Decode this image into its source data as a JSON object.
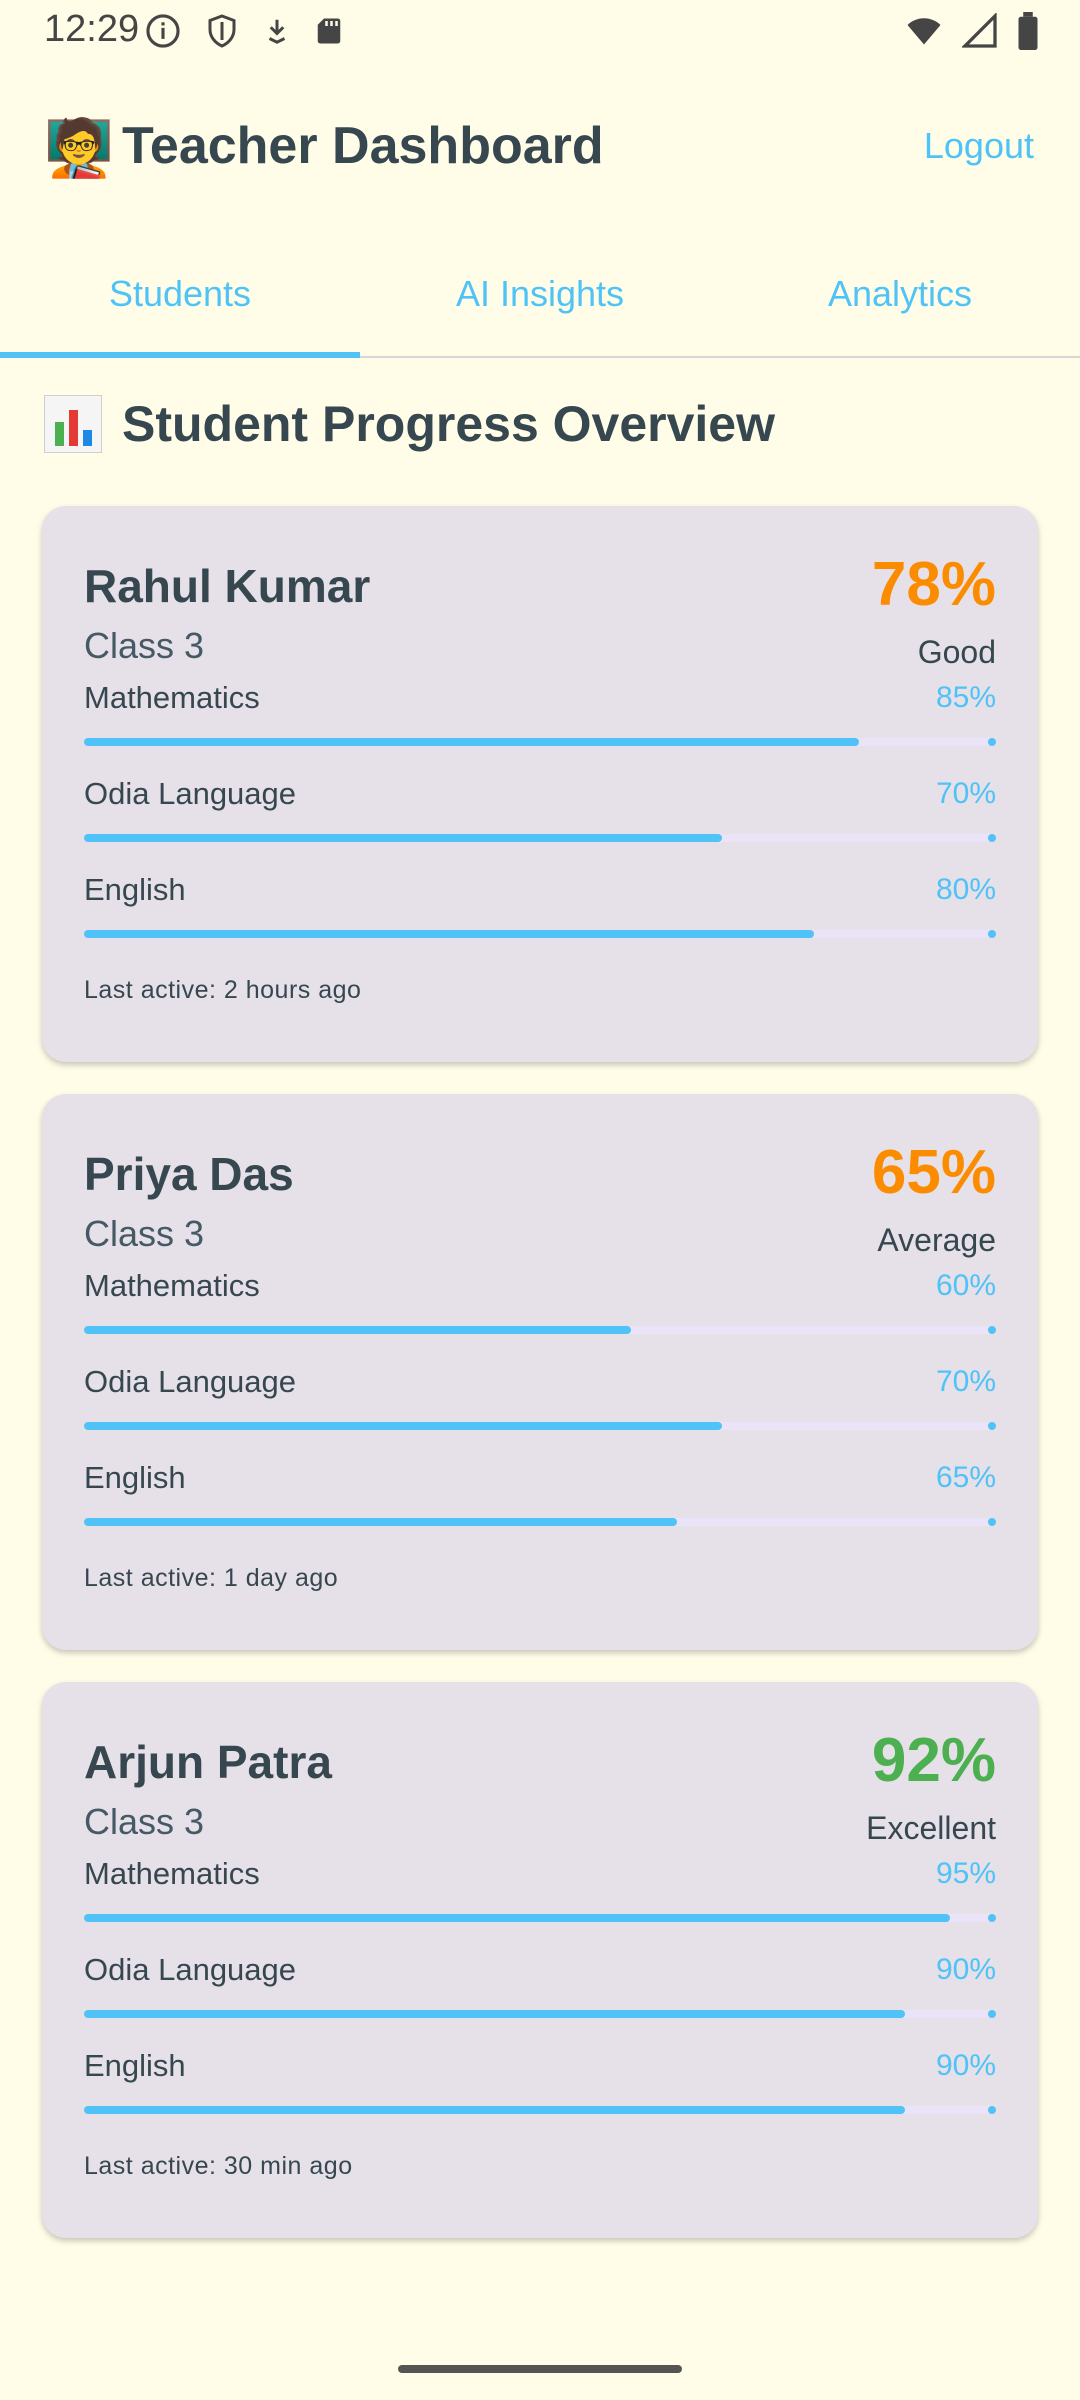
{
  "status_bar": {
    "time": "12:29",
    "left_icons": [
      "info-icon",
      "shield-icon",
      "download-arrow-icon",
      "sd-card-icon"
    ],
    "right_icons": [
      "wifi-icon",
      "signal-icon",
      "battery-icon"
    ]
  },
  "header": {
    "emoji": "🧑‍🏫",
    "title": "Teacher Dashboard",
    "logout_label": "Logout"
  },
  "tabs": [
    {
      "label": "Students",
      "active": true
    },
    {
      "label": "AI Insights",
      "active": false
    },
    {
      "label": "Analytics",
      "active": false
    }
  ],
  "section": {
    "icon": "bar-chart-icon",
    "title": "Student Progress Overview"
  },
  "colors": {
    "accent": "#4FC3F7",
    "score_orange": "#FB8C00",
    "score_green": "#4CAF50",
    "card_bg": "#E6E0E9",
    "page_bg": "#FFFDE8"
  },
  "students": [
    {
      "name": "Rahul Kumar",
      "class": "Class 3",
      "score": "78%",
      "grade": "Good",
      "score_color": "#FB8C00",
      "subjects": [
        {
          "name": "Mathematics",
          "pct": "85%",
          "value": 0.85
        },
        {
          "name": "Odia Language",
          "pct": "70%",
          "value": 0.7
        },
        {
          "name": "English",
          "pct": "80%",
          "value": 0.8
        }
      ],
      "last_active": "Last active: 2 hours ago"
    },
    {
      "name": "Priya Das",
      "class": "Class 3",
      "score": "65%",
      "grade": "Average",
      "score_color": "#FB8C00",
      "subjects": [
        {
          "name": "Mathematics",
          "pct": "60%",
          "value": 0.6
        },
        {
          "name": "Odia Language",
          "pct": "70%",
          "value": 0.7
        },
        {
          "name": "English",
          "pct": "65%",
          "value": 0.65
        }
      ],
      "last_active": "Last active: 1 day ago"
    },
    {
      "name": "Arjun Patra",
      "class": "Class 3",
      "score": "92%",
      "grade": "Excellent",
      "score_color": "#4CAF50",
      "subjects": [
        {
          "name": "Mathematics",
          "pct": "95%",
          "value": 0.95
        },
        {
          "name": "Odia Language",
          "pct": "90%",
          "value": 0.9
        },
        {
          "name": "English",
          "pct": "90%",
          "value": 0.9
        }
      ],
      "last_active": "Last active: 30 min ago"
    }
  ]
}
